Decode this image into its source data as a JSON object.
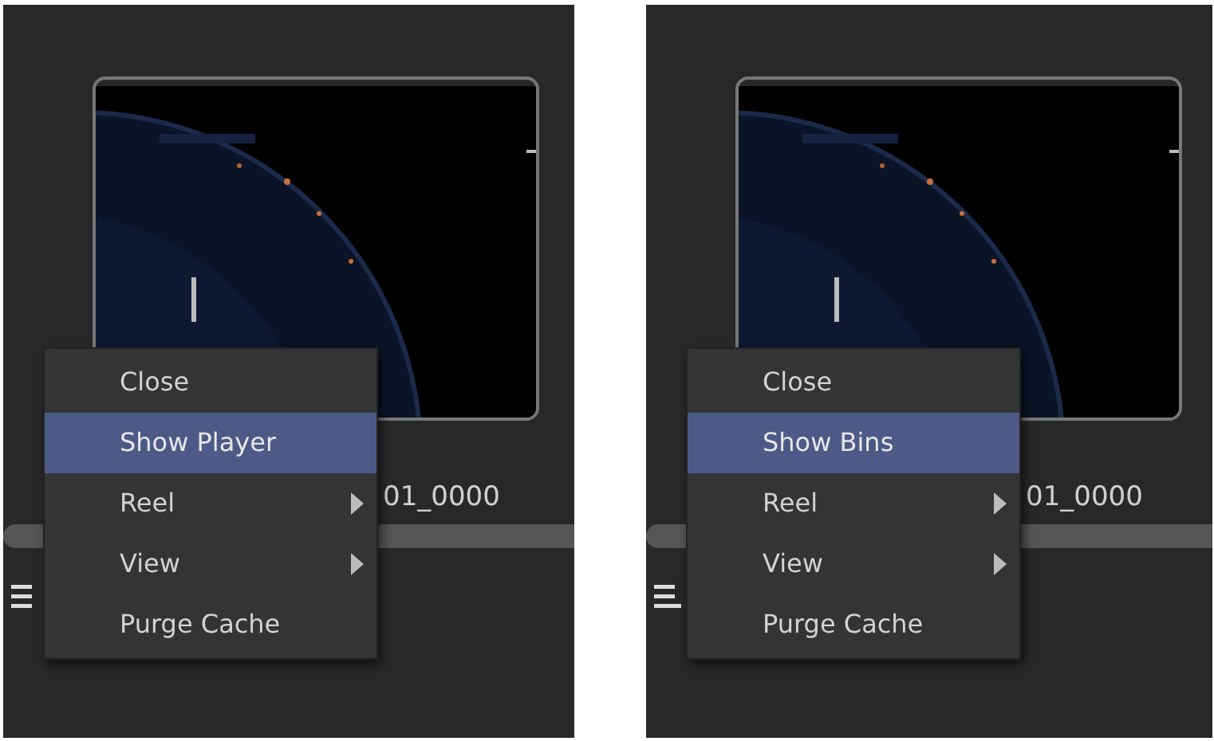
{
  "panels": [
    {
      "caption": "01_0000",
      "menu": [
        {
          "label": "Close",
          "selected": false,
          "submenu": false
        },
        {
          "label": "Show Player",
          "selected": true,
          "submenu": false
        },
        {
          "label": "Reel",
          "selected": false,
          "submenu": true
        },
        {
          "label": "View",
          "selected": false,
          "submenu": true
        },
        {
          "label": "Purge Cache",
          "selected": false,
          "submenu": false
        }
      ]
    },
    {
      "caption": "01_0000",
      "menu": [
        {
          "label": "Close",
          "selected": false,
          "submenu": false
        },
        {
          "label": "Show Bins",
          "selected": true,
          "submenu": false
        },
        {
          "label": "Reel",
          "selected": false,
          "submenu": true
        },
        {
          "label": "View",
          "selected": false,
          "submenu": true
        },
        {
          "label": "Purge Cache",
          "selected": false,
          "submenu": false
        }
      ]
    }
  ]
}
